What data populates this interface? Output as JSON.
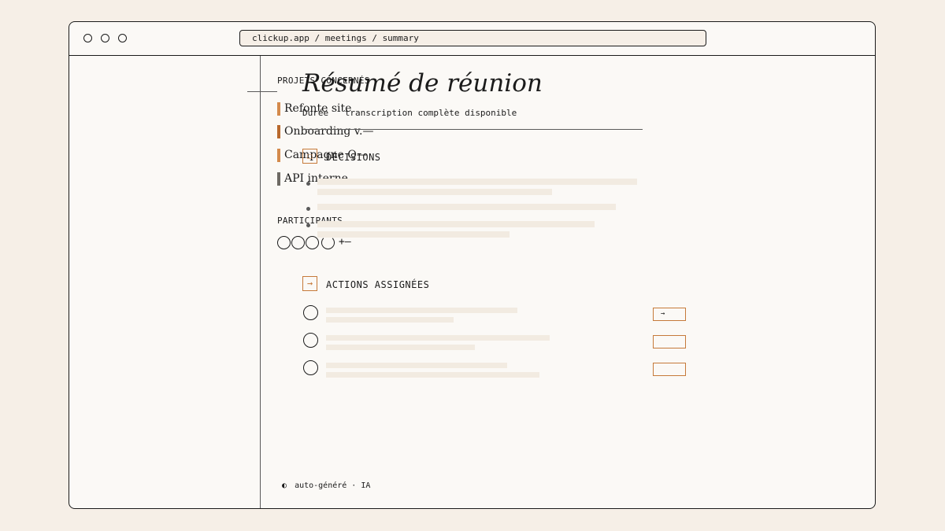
{
  "browser": {
    "url": "clickup.app / meetings / summary"
  },
  "sidebar": {
    "projects_label": "PROJETS CONCERNÉS",
    "projects": [
      {
        "label": "Refonte site",
        "color": "#d48a4c"
      },
      {
        "label": "Onboarding v.—",
        "color": "#b9692d"
      },
      {
        "label": "Campagne Q—",
        "color": "#d48a4c"
      },
      {
        "label": "API interne",
        "color": "#6e6a64"
      }
    ],
    "participants_label": "PARTICIPANTS",
    "more_glyph": "+—"
  },
  "main": {
    "title": "Résumé de réunion",
    "meta": {
      "duration_label": "Durée",
      "transcript": "transcription complète disponible"
    },
    "decisions": {
      "icon_glyph": "☐",
      "heading": "DÉCISIONS"
    },
    "actions": {
      "icon_glyph": "→",
      "heading": "ACTIONS ASSIGNÉES",
      "rows": [
        {
          "button_label": "→"
        },
        {
          "button_label": ""
        },
        {
          "button_label": ""
        }
      ]
    },
    "footer": {
      "icon_glyph": "◐",
      "text": "auto-généré · IA"
    }
  },
  "colors": {
    "accent": "#c67a3a",
    "placeholder": "#f2ebe1",
    "border": "#1b1b1b"
  }
}
